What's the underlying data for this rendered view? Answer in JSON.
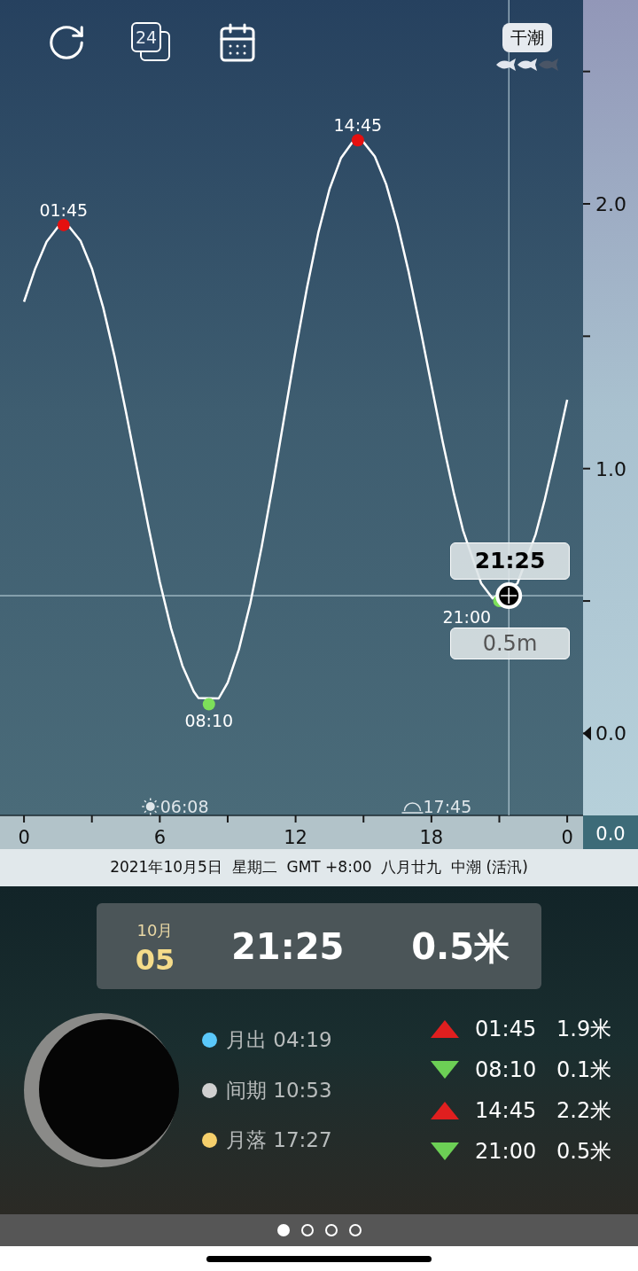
{
  "header": {
    "hours_icon_label": "24",
    "tide_badge": "干潮",
    "stars": 2
  },
  "chart": {
    "chart_data": {
      "type": "line",
      "xlim": [
        -1.06,
        24.7
      ],
      "ylim": [
        -0.31,
        2.77
      ],
      "xticks": [
        0,
        6,
        12,
        18
      ],
      "yticks": [
        {
          "value": 0,
          "label": "0.0"
        },
        {
          "value": 1,
          "label": "1.0"
        },
        {
          "value": 2,
          "label": "2.0"
        }
      ],
      "x": [
        0,
        0.5,
        1,
        1.5,
        2,
        2.5,
        3,
        3.5,
        4,
        4.5,
        5,
        5.5,
        6,
        6.5,
        7,
        7.5,
        7.7,
        8.6,
        9,
        9.5,
        10,
        10.5,
        11,
        11.5,
        12,
        12.5,
        13,
        13.5,
        14,
        14.5,
        15,
        15.5,
        16,
        16.5,
        17,
        17.5,
        18,
        18.5,
        19,
        19.4,
        20.2,
        20.7,
        21.8,
        22.6,
        23,
        23.5,
        24
      ],
      "series": [
        {
          "color": "#ffffff",
          "values": [
            1.63,
            1.756,
            1.857,
            1.913,
            1.913,
            1.86,
            1.756,
            1.608,
            1.424,
            1.217,
            0.997,
            0.779,
            0.573,
            0.396,
            0.255,
            0.158,
            0.134,
            0.132,
            0.192,
            0.318,
            0.491,
            0.704,
            0.943,
            1.195,
            1.447,
            1.682,
            1.89,
            2.056,
            2.172,
            2.232,
            2.233,
            2.179,
            2.074,
            1.924,
            1.741,
            1.533,
            1.315,
            1.101,
            0.904,
            0.766,
            0.566,
            0.51,
            0.566,
            0.751,
            0.88,
            1.063,
            1.26
          ]
        }
      ],
      "annotations": [
        {
          "x": 1.75,
          "y": 1.92,
          "text": "01:45"
        },
        {
          "x": 8.17,
          "y": 0.11,
          "text": "08:10"
        },
        {
          "x": 14.75,
          "y": 2.24,
          "text": "14:45"
        },
        {
          "x": 21,
          "y": 0.5,
          "text": "21:00"
        }
      ],
      "ref_lines": [
        {
          "axis": "x",
          "value": 21.42
        },
        {
          "axis": "y",
          "value": 0.52
        }
      ]
    },
    "cursor": {
      "time": "21:25",
      "height": "0.5m"
    },
    "sun_events": [
      {
        "kind": "sunrise",
        "time": "06:08"
      },
      {
        "kind": "sunset",
        "time": "17:45"
      }
    ],
    "next_day_label": "0",
    "readout": "0.0"
  },
  "date_bar": "2021年10月5日  星期二  GMT +8:00  八月廿九  中潮 (活汛)",
  "summary": {
    "month": "10月",
    "day": "05",
    "time": "21:25",
    "height": "0.5米"
  },
  "moon_events": [
    {
      "label": "月出 04:19",
      "color": "#5ac8fa"
    },
    {
      "label": "间期 10:53",
      "color": "#d0d0d0"
    },
    {
      "label": "月落 17:27",
      "color": "#f5cf6b"
    }
  ],
  "tides": [
    {
      "kind": "high",
      "time": "01:45",
      "height": "1.9米"
    },
    {
      "kind": "low",
      "time": "08:10",
      "height": "0.1米"
    },
    {
      "kind": "high",
      "time": "14:45",
      "height": "2.2米"
    },
    {
      "kind": "low",
      "time": "21:00",
      "height": "0.5米"
    }
  ],
  "pages": [
    {
      "selected": true
    },
    {
      "selected": false
    },
    {
      "selected": false
    },
    {
      "selected": false
    }
  ]
}
